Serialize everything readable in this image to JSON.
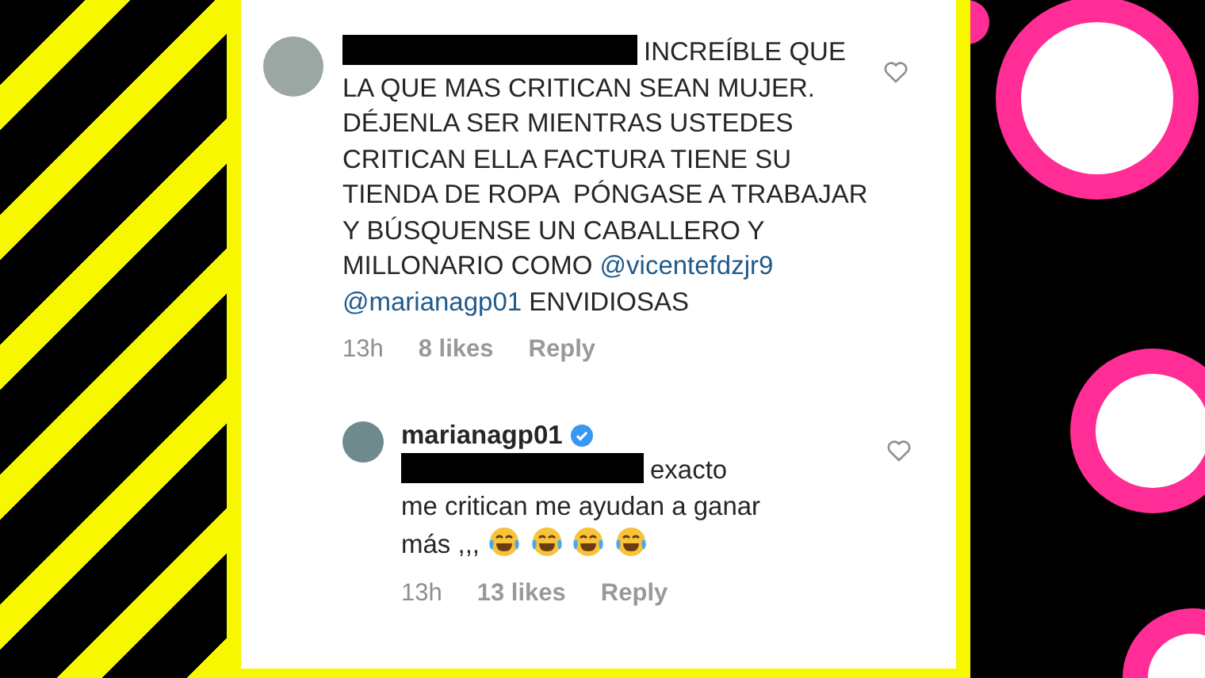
{
  "comments": [
    {
      "verified": false,
      "redacted_prefix": true,
      "liked": false,
      "parts": [
        {
          "kind": "text",
          "text": "INCREÍBLE QUE LA QUE MAS CRITICAN SEAN MUJER. DÉJENLA SER MIENTRAS USTEDES CRITICAN ELLA FACTURA TIENE SU TIENDA DE ROPA  PÓNGASE A TRABAJAR Y BÚSQUENSE UN CABALLERO Y MILLONARIO COMO"
        },
        {
          "kind": "mention",
          "text": "@vicentefdzjr9"
        },
        {
          "kind": "mention",
          "text": "@marianagp01"
        },
        {
          "kind": "text",
          "text": "ENVIDIOSAS"
        }
      ],
      "time": "13h",
      "likes": "8 likes",
      "reply": "Reply",
      "is_reply": false
    },
    {
      "username": "marianagp01",
      "verified": true,
      "redacted_prefix": true,
      "liked": false,
      "parts": [
        {
          "kind": "text",
          "text": "exacto me critican me ayudan a ganar más ,,,"
        },
        {
          "kind": "emoji"
        },
        {
          "kind": "emoji"
        },
        {
          "kind": "emoji"
        },
        {
          "kind": "emoji"
        }
      ],
      "time": "13h",
      "likes": "13 likes",
      "reply": "Reply",
      "is_reply": true
    }
  ]
}
